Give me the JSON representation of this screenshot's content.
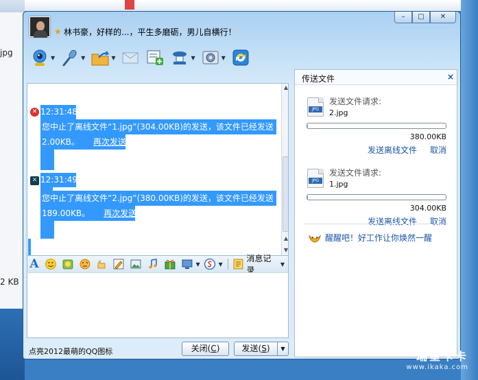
{
  "background": {
    "left_file_label": "jpg",
    "left_size_label": "2 KB",
    "watermark_main": "瑞星卡卡",
    "watermark_url": "www.ikaka.com"
  },
  "window": {
    "title": "林书豪，好样的...，平生多磨砺，男儿自横行！",
    "controls": {
      "minimize": "–",
      "maximize": "□",
      "close": "✕"
    }
  },
  "toolbar": {
    "icons": [
      "video-call-icon",
      "voice-call-icon",
      "send-file-icon",
      "mail-icon",
      "add-app-icon",
      "meeting-icon",
      "settings-icon",
      "sync-icon"
    ]
  },
  "chat": {
    "messages": [
      {
        "time": "12:31:48",
        "line1": "您中止了离线文件“1.jpg”(304.00KB)的发送，该文件已经发送",
        "line2": "2.00KB。",
        "resend": "再次发送"
      },
      {
        "time": "12:31:49",
        "line1": "您中止了离线文件“2.jpg”(380.00KB)的发送，该文件已经发送",
        "line2": "189.00KB。",
        "resend": "再次发送"
      }
    ]
  },
  "format_bar": {
    "font_glyph": "A",
    "history_label": "消息记录"
  },
  "bottom": {
    "tip": "点亮2012最萌的QQ图标",
    "close_prefix": "关闭(",
    "close_key": "C",
    "send_prefix": "发送(",
    "send_key": "S",
    "suffix": ")"
  },
  "transfer": {
    "title": "传送文件",
    "close": "×",
    "files": [
      {
        "request": "发送文件请求:",
        "name": "2.jpg",
        "type": "JPG",
        "size": "380.00KB",
        "progress": 0.005,
        "offline": "发送离线文件",
        "cancel": "取消"
      },
      {
        "request": "发送文件请求:",
        "name": "1.jpg",
        "type": "JPG",
        "size": "304.00KB",
        "progress": 0.005,
        "offline": "发送离线文件",
        "cancel": "取消"
      }
    ],
    "promo": "醒醒吧！好工作让你焕然一醒"
  },
  "colors": {
    "selection": "#3399ff",
    "link": "#1a56a8",
    "window_border": "#1e5a93"
  }
}
